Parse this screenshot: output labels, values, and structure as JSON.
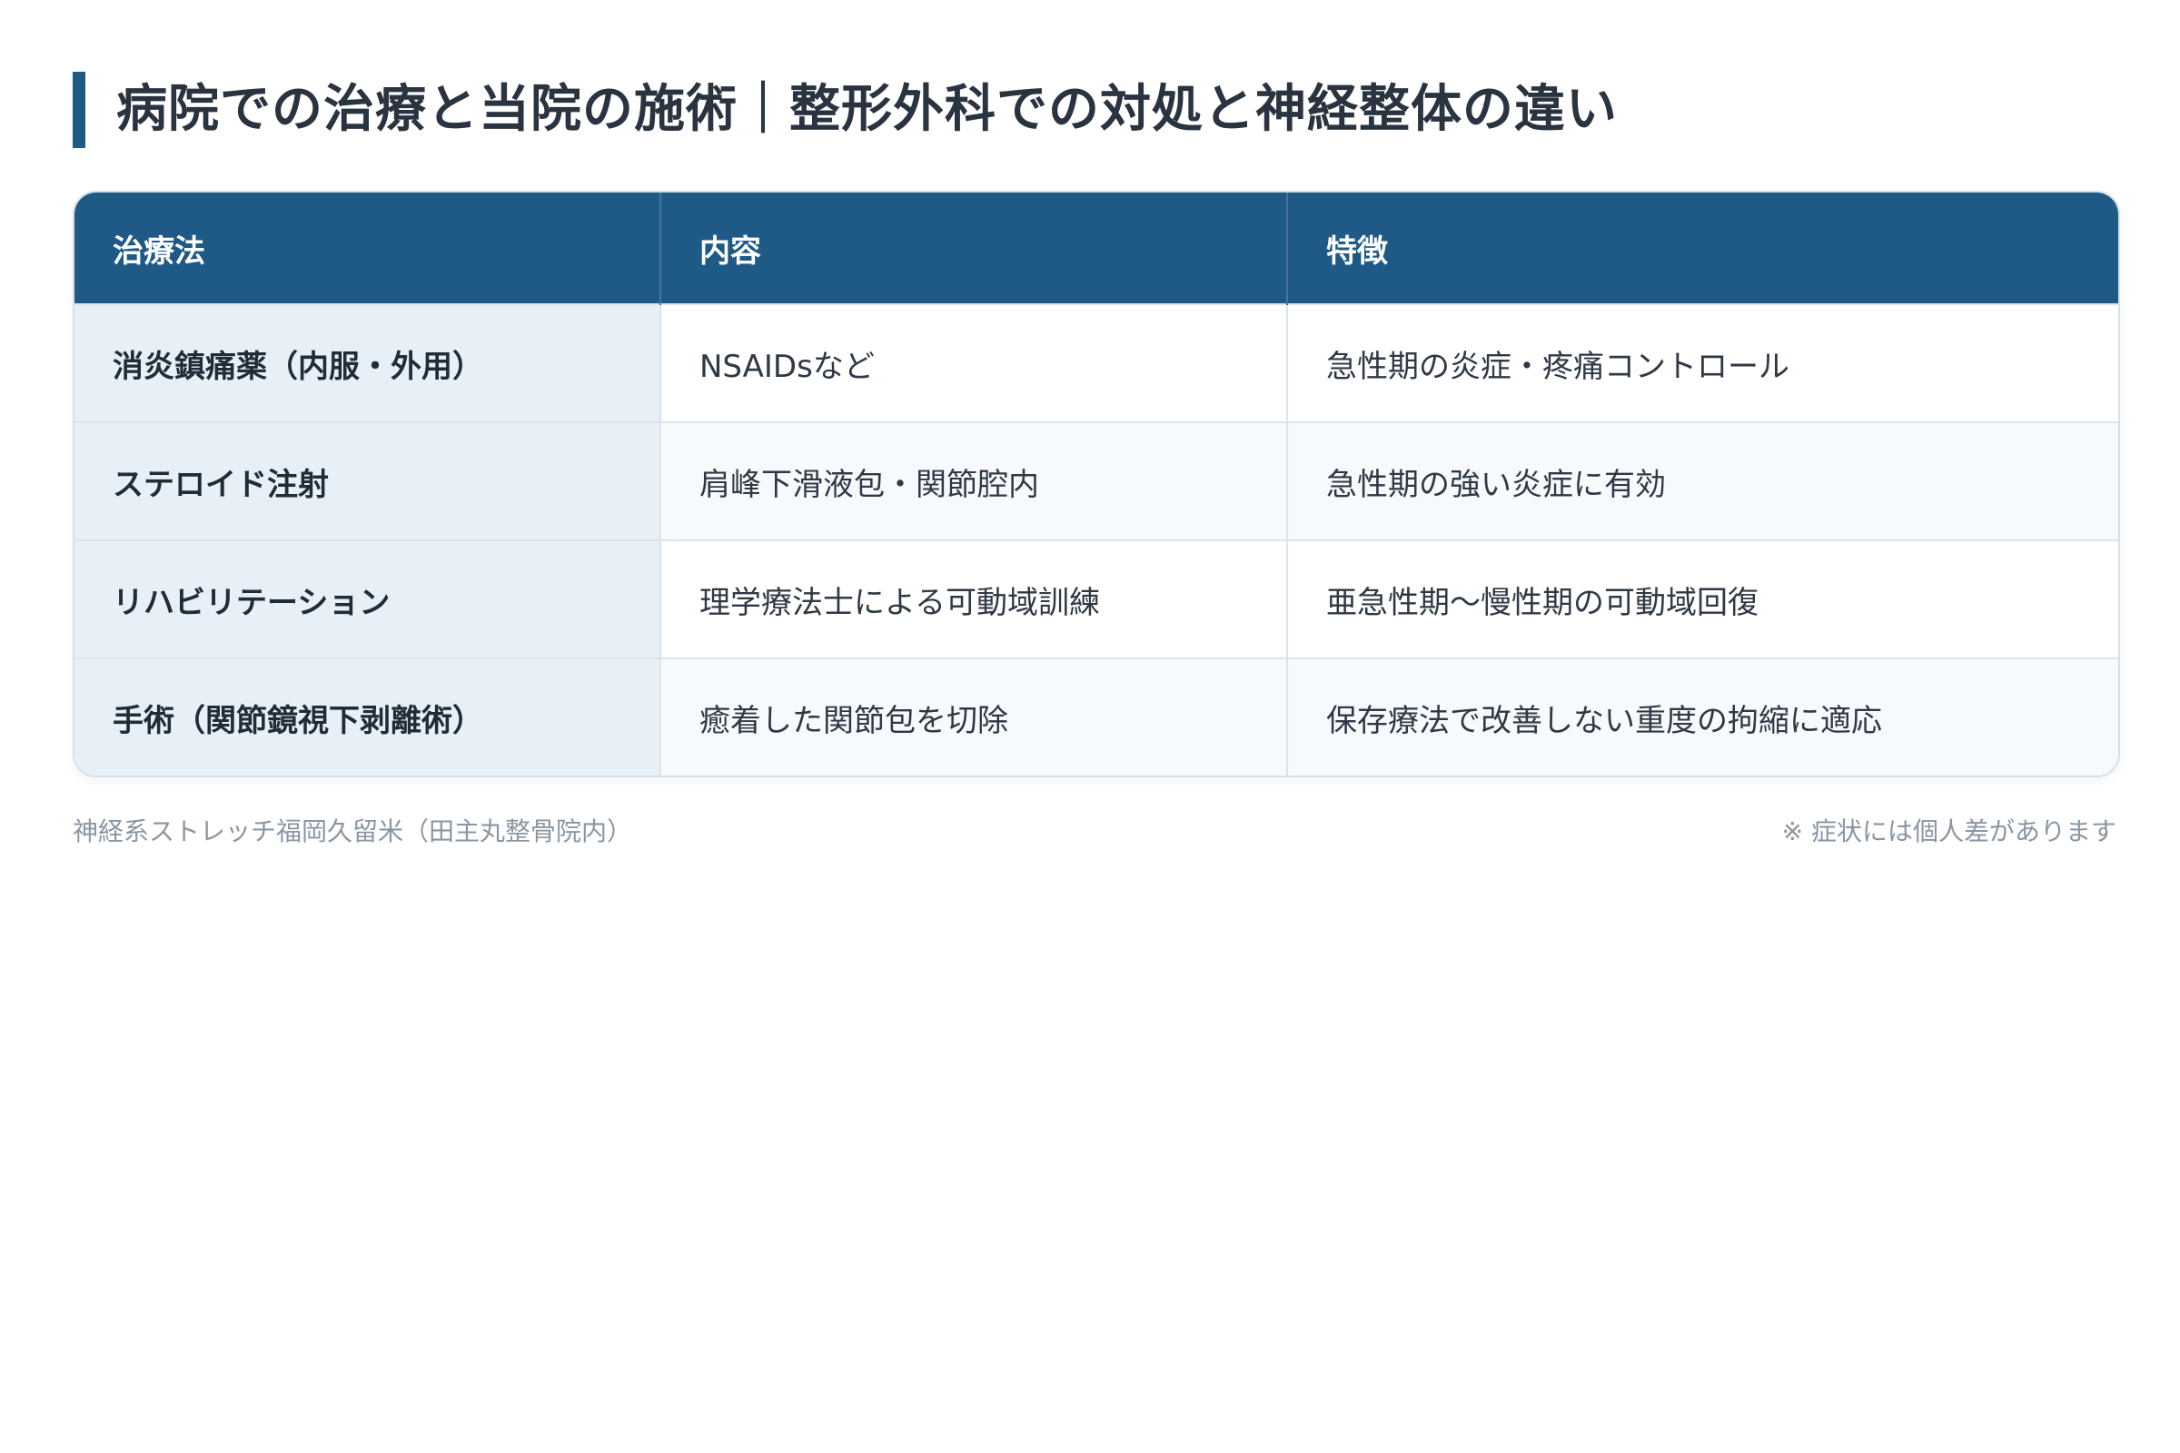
{
  "page": {
    "title": "病院での治療と当院の施術｜整形外科での対処と神経整体の違い"
  },
  "table": {
    "headers": [
      "治療法",
      "内容",
      "特徴"
    ],
    "rows": [
      {
        "method": "消炎鎮痛薬（内服・外用）",
        "content": "NSAIDsなど",
        "feature": "急性期の炎症・疼痛コントロール"
      },
      {
        "method": "ステロイド注射",
        "content": "肩峰下滑液包・関節腔内",
        "feature": "急性期の強い炎症に有効"
      },
      {
        "method": "リハビリテーション",
        "content": "理学療法士による可動域訓練",
        "feature": "亜急性期〜慢性期の可動域回復"
      },
      {
        "method": "手術（関節鏡視下剥離術）",
        "content": "癒着した関節包を切除",
        "feature": "保存療法で改善しない重度の拘縮に適応"
      }
    ]
  },
  "footer": {
    "source": "神経系ストレッチ福岡久留米（田主丸整骨院内）",
    "note": "※ 症状には個人差があります"
  },
  "colors": {
    "accent": "#1f5a87",
    "label_cell_bg": "#e8f0f7",
    "border": "#d5e0ea",
    "muted_text": "#8a96a3"
  }
}
